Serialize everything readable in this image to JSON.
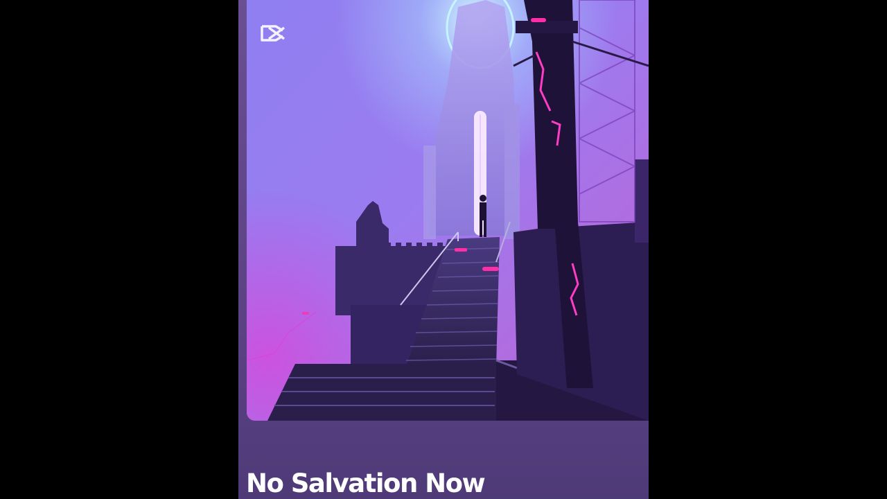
{
  "video": {
    "title": "No Salvation Now",
    "watermark_icon": "capcut-logo-icon"
  },
  "artwork": {
    "subject": "lone figure climbing stairs toward a gothic tower in neon purple fog",
    "colors": {
      "fog_top": "#8a7ae8",
      "fog_mid": "#a070e6",
      "neon_pink": "#ff2ea8",
      "glow_cyan": "#9ff6ff",
      "shadow": "#2a1a48",
      "card_bg": "#5a4182"
    }
  }
}
